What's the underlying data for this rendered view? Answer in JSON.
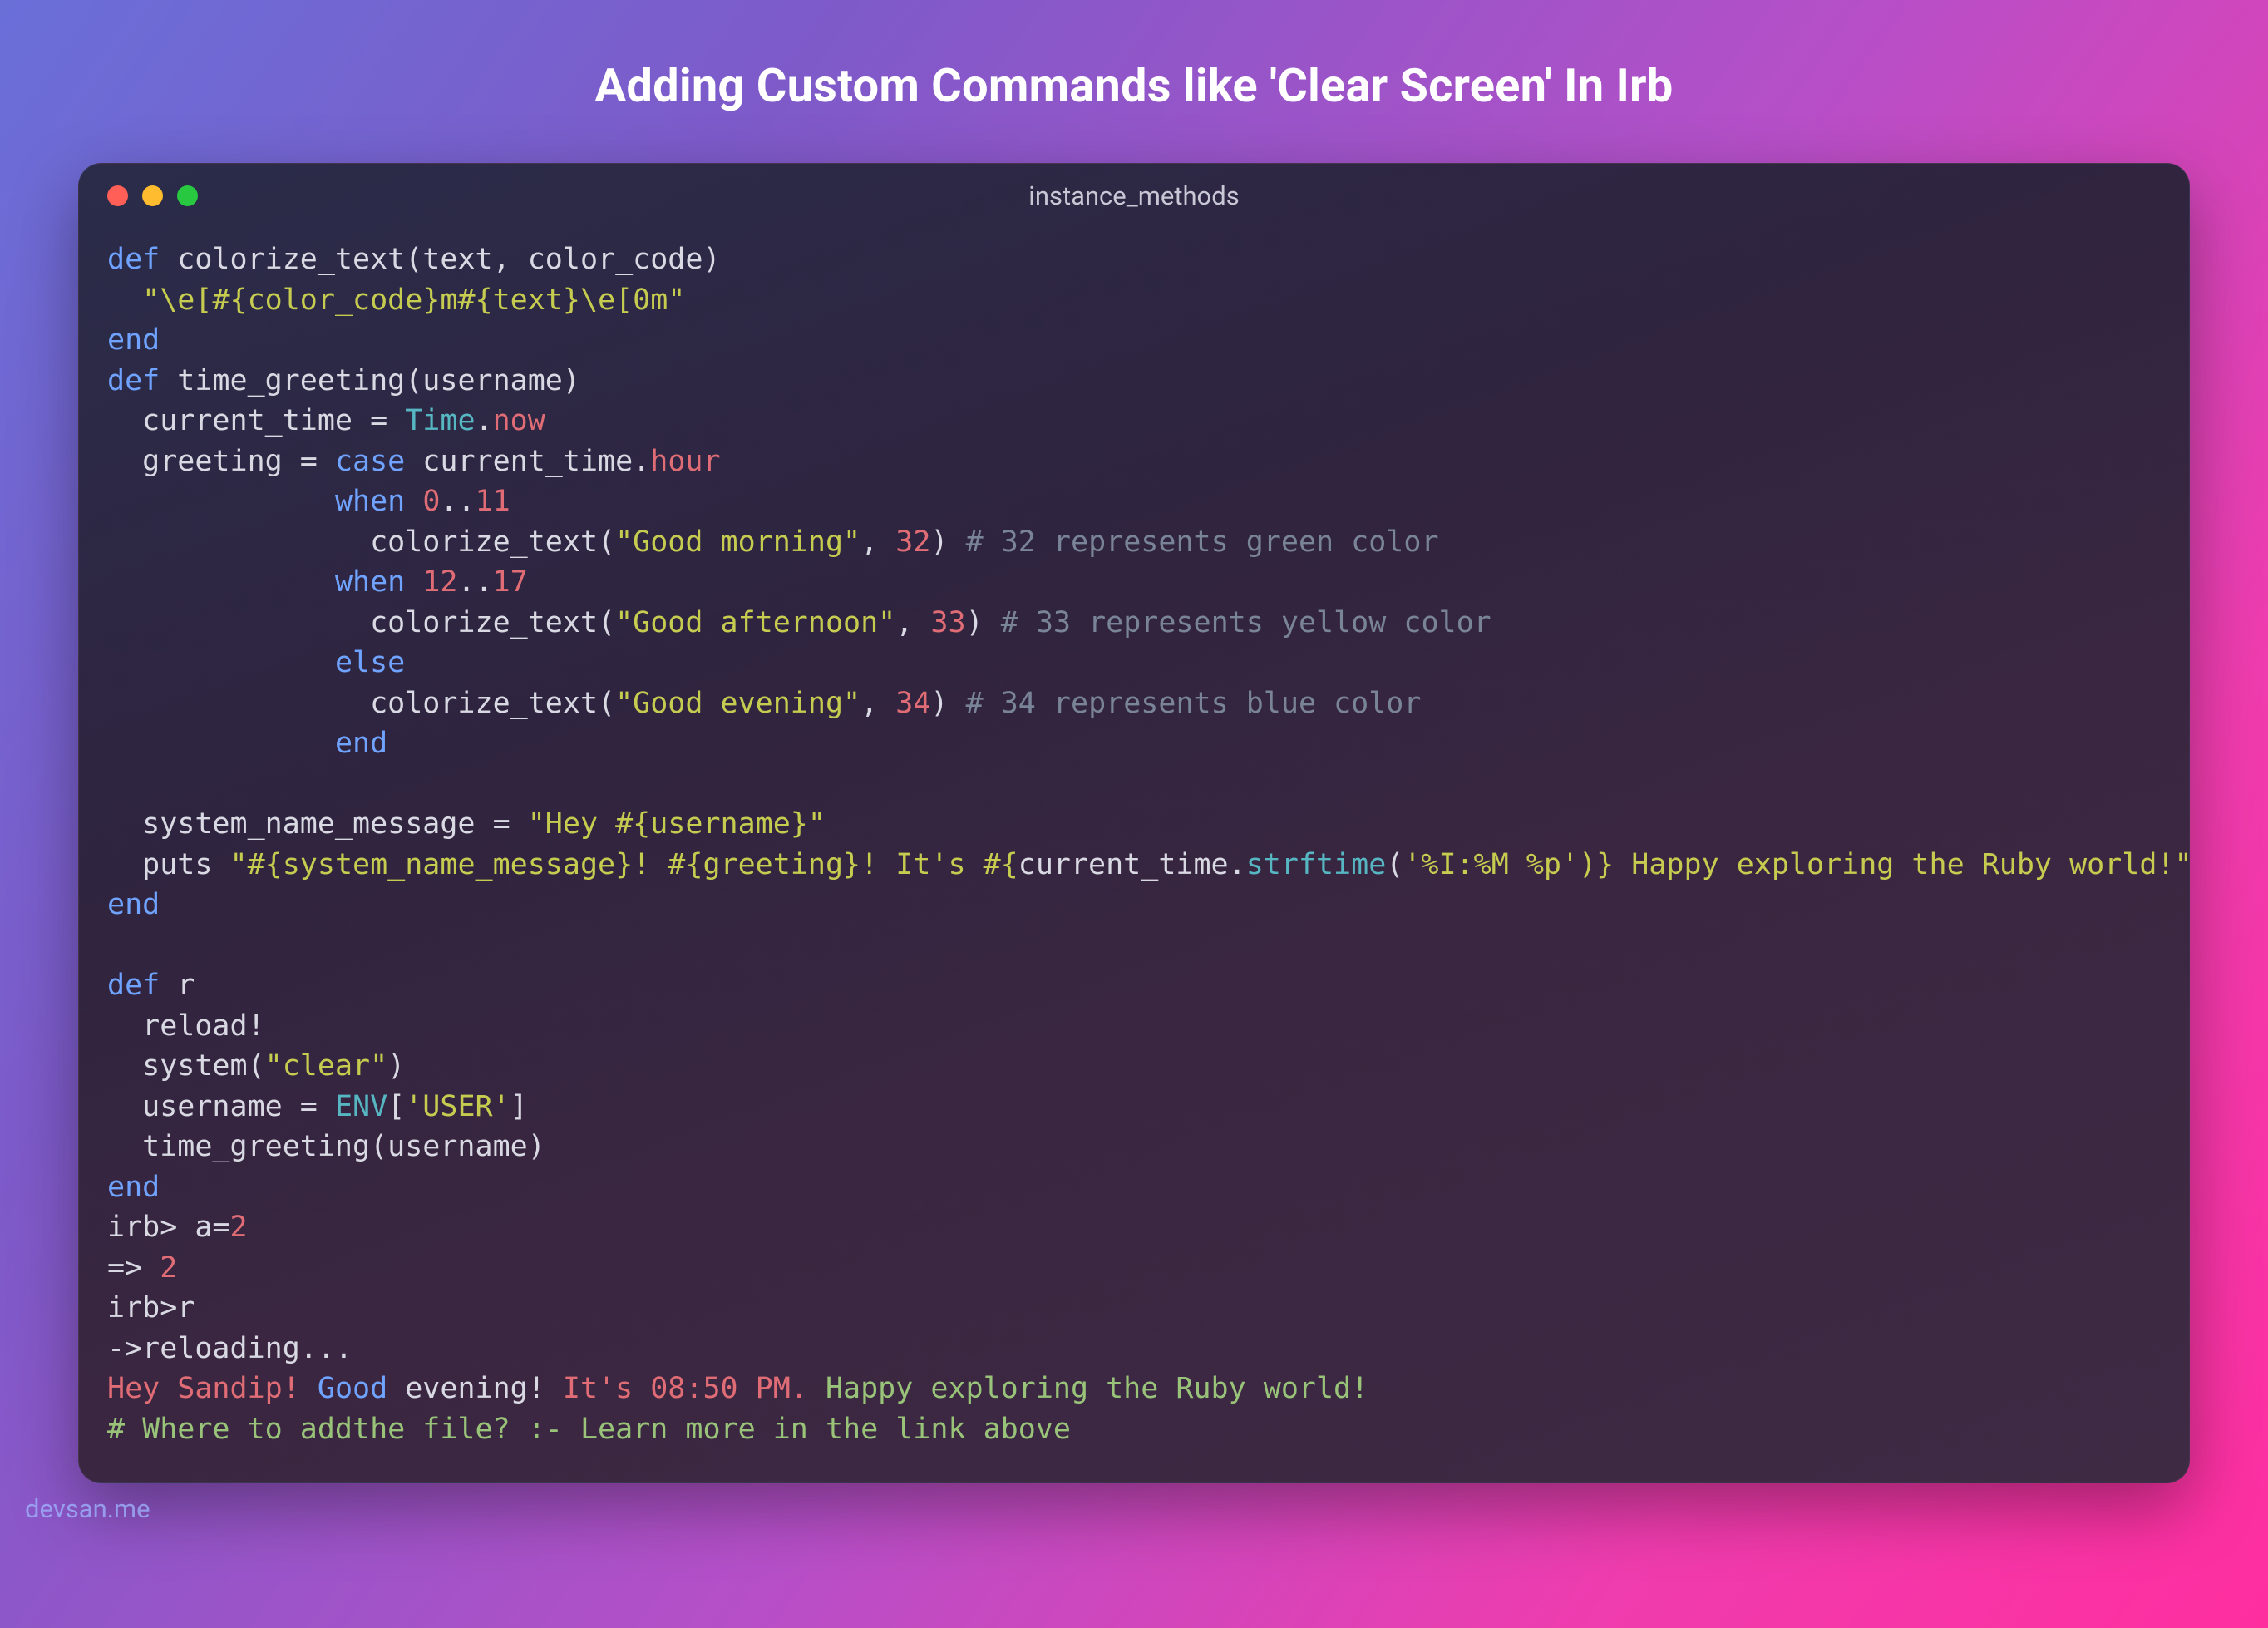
{
  "page_title": "Adding Custom Commands like 'Clear Screen' In Irb",
  "window_title": "instance_methods",
  "footer": "devsan.me",
  "traffic": {
    "red": "#ff5f57",
    "yellow": "#febc2e",
    "green": "#28c840"
  },
  "code": {
    "l1": {
      "kw": "def",
      "rest": " colorize_text(text, color_code)"
    },
    "l2": {
      "indent": "  ",
      "str": "\"\\e[#{color_code}m#{text}\\e[0m\""
    },
    "l3": {
      "kw": "end"
    },
    "l4": {
      "kw": "def",
      "rest": " time_greeting(username)"
    },
    "l5": {
      "indent": "  current_time = ",
      "const": "Time",
      "dot": ".",
      "meth": "now"
    },
    "l6": {
      "indent": "  greeting = ",
      "kw": "case",
      "mid": " current_time.",
      "meth": "hour"
    },
    "l7": {
      "indent": "             ",
      "kw": "when",
      "sp": " ",
      "n1": "0",
      "range": "..",
      "n2": "11"
    },
    "l8": {
      "indent": "               colorize_text(",
      "str": "\"Good morning\"",
      "comma": ", ",
      "num": "32",
      "paren": ") ",
      "cmt": "# 32 represents green color"
    },
    "l9": {
      "indent": "             ",
      "kw": "when",
      "sp": " ",
      "n1": "12",
      "range": "..",
      "n2": "17"
    },
    "l10": {
      "indent": "               colorize_text(",
      "str": "\"Good afternoon\"",
      "comma": ", ",
      "num": "33",
      "paren": ") ",
      "cmt": "# 33 represents yellow color"
    },
    "l11": {
      "indent": "             ",
      "kw": "else"
    },
    "l12": {
      "indent": "               colorize_text(",
      "str": "\"Good evening\"",
      "comma": ", ",
      "num": "34",
      "paren": ") ",
      "cmt": "# 34 represents blue color"
    },
    "l13": {
      "indent": "             ",
      "kw": "end"
    },
    "blank1": "",
    "l14": {
      "indent": "  system_name_message = ",
      "str": "\"Hey #{username}\""
    },
    "l15": {
      "indent": "  puts ",
      "s1": "\"#{system_name_message}! #{greeting}! It's #{",
      "mid": "current_time.",
      "meth": "strftime",
      "paren": "(",
      "s2": "'%I:%M %p'",
      "s3": ")} Happy exploring the Ruby world!\""
    },
    "l16": {
      "kw": "end"
    },
    "blank2": "",
    "l17": {
      "kw": "def",
      "rest": " r"
    },
    "l18": {
      "txt": "  reload!"
    },
    "l19": {
      "indent": "  system(",
      "str": "\"clear\"",
      "paren": ")"
    },
    "l20": {
      "indent": "  username = ",
      "const": "ENV",
      "br": "[",
      "str": "'USER'",
      "br2": "]"
    },
    "l21": {
      "txt": "  time_greeting(username)"
    },
    "l22": {
      "kw": "end"
    },
    "l23": {
      "p": "irb> a=",
      "num": "2"
    },
    "l24": {
      "p": "=> ",
      "num": "2"
    },
    "l25": {
      "txt": "irb>r"
    },
    "l26": {
      "txt": "->reloading..."
    },
    "l27": {
      "a": "Hey Sandip!",
      "b": " Good",
      "c": " evening! ",
      "d": "It's 08:50 PM.",
      "e": " Happy exploring the Ruby world!"
    },
    "l28": {
      "cmt": "# Where to addthe file? :- Learn more in the link above"
    }
  }
}
